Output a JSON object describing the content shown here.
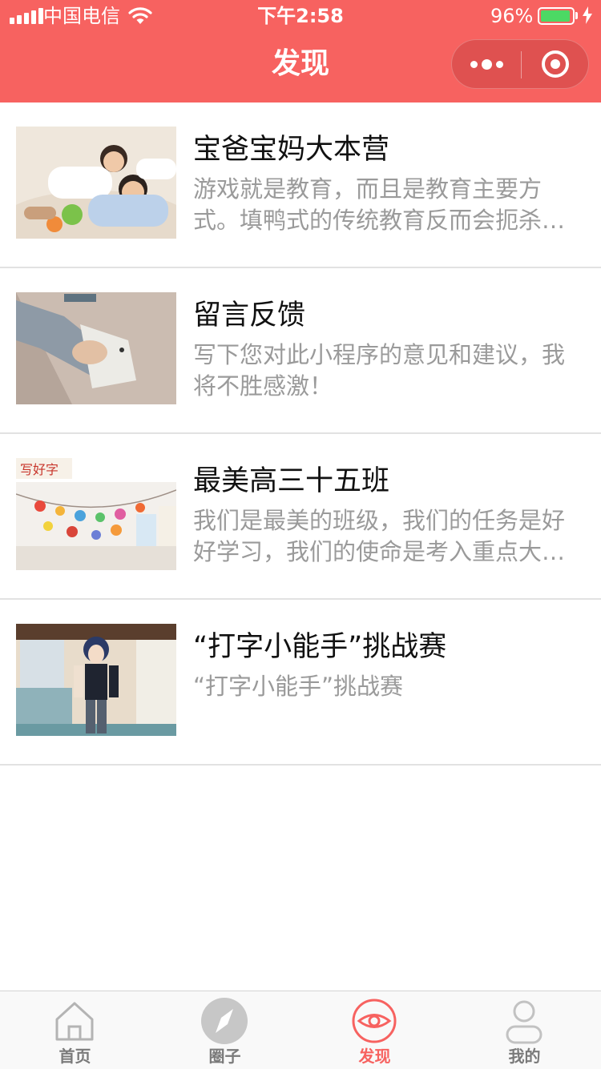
{
  "status_bar": {
    "carrier": "中国电信",
    "time": "下午2:58",
    "battery_percent": "96%",
    "battery_level": 0.96
  },
  "nav": {
    "title": "发现",
    "more_icon": "more-dots-icon",
    "close_icon": "record-circle-icon"
  },
  "colors": {
    "brand": "#f76260",
    "text_primary": "#111111",
    "text_secondary": "#9a9a9a",
    "tab_inactive": "#7a7a7a",
    "battery_green": "#4cd964"
  },
  "items": [
    {
      "title": "宝爸宝妈大本营",
      "desc": "游戏就是教育，而且是教育主要方式。填鸭式的传统教育反而会扼杀孩子的天性。",
      "image": "family-photo"
    },
    {
      "title": "留言反馈",
      "desc": "写下您对此小程序的意见和建议，我将不胜感激！",
      "image": "writing-hand-photo"
    },
    {
      "title": "最美高三十五班",
      "desc": "我们是最美的班级，我们的任务是好好学习，我们的使命是考入重点大学。",
      "image": "classroom-photo"
    },
    {
      "title": "“打字小能手”挑战赛",
      "desc": "“打字小能手”挑战赛",
      "image": "anime-character-photo"
    }
  ],
  "tabbar": {
    "tabs": [
      {
        "label": "首页",
        "icon": "home-icon",
        "active": false
      },
      {
        "label": "圈子",
        "icon": "compass-icon",
        "active": false
      },
      {
        "label": "发现",
        "icon": "eye-icon",
        "active": true
      },
      {
        "label": "我的",
        "icon": "user-icon",
        "active": false
      }
    ]
  }
}
